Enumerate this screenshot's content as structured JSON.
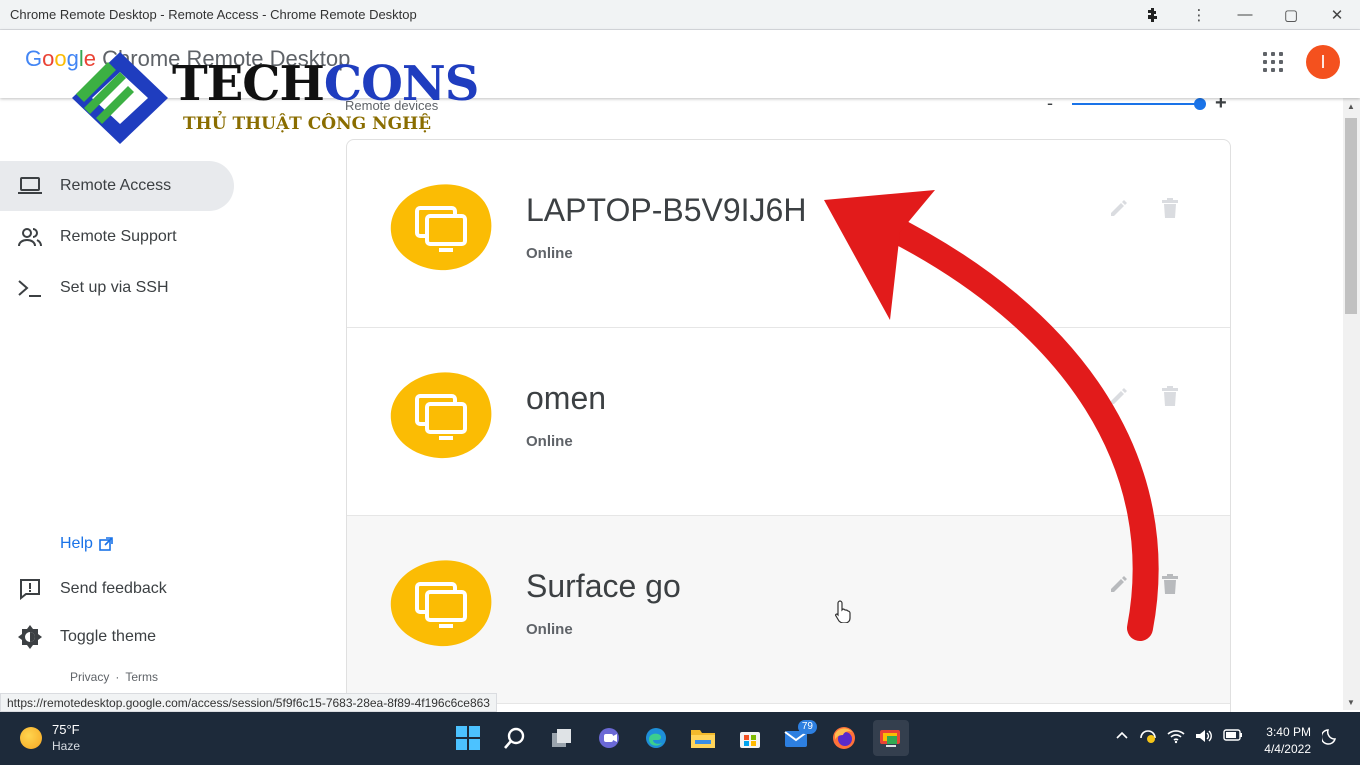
{
  "window": {
    "title": "Chrome Remote Desktop - Remote Access - Chrome Remote Desktop",
    "buttons": {
      "extensions": "extensions-icon",
      "menu": "⋮",
      "minimize": "—",
      "maximize": "▢",
      "close": "✕"
    }
  },
  "header": {
    "brand_google": "Google",
    "brand_product": "Chrome Remote Desktop",
    "avatar_initial": "I"
  },
  "watermark": {
    "tech": "TECH",
    "cons": "CONS",
    "subtitle": "THỦ THUẬT CÔNG NGHỆ"
  },
  "sidebar": {
    "items": [
      {
        "label": "Remote Access",
        "icon": "laptop-icon",
        "active": true
      },
      {
        "label": "Remote Support",
        "icon": "people-icon",
        "active": false
      },
      {
        "label": "Set up via SSH",
        "icon": "terminal-icon",
        "active": false
      }
    ],
    "help": "Help",
    "send_feedback": "Send feedback",
    "toggle_theme": "Toggle theme",
    "privacy": "Privacy",
    "separator": "·",
    "terms": "Terms"
  },
  "main": {
    "section_label": "Remote devices",
    "zoom": {
      "minus": "-",
      "plus": "+",
      "level": 0.95
    },
    "devices": [
      {
        "name": "LAPTOP-B5V9IJ6H",
        "status": "Online"
      },
      {
        "name": "omen",
        "status": "Online"
      },
      {
        "name": "Surface go",
        "status": "Online"
      }
    ]
  },
  "status_url": "https://remotedesktop.google.com/access/session/5f9f6c15-7683-28ea-8f89-4f196c6ce863",
  "taskbar": {
    "weather_temp": "75°F",
    "weather_cond": "Haze",
    "mail_badge": "79",
    "time": "3:40 PM",
    "date": "4/4/2022"
  },
  "colors": {
    "accent": "#1a73e8",
    "device_icon": "#fbbc04",
    "arrow": "#e21b1b",
    "avatar": "#f4511e",
    "taskbar": "#1d2a3a"
  }
}
